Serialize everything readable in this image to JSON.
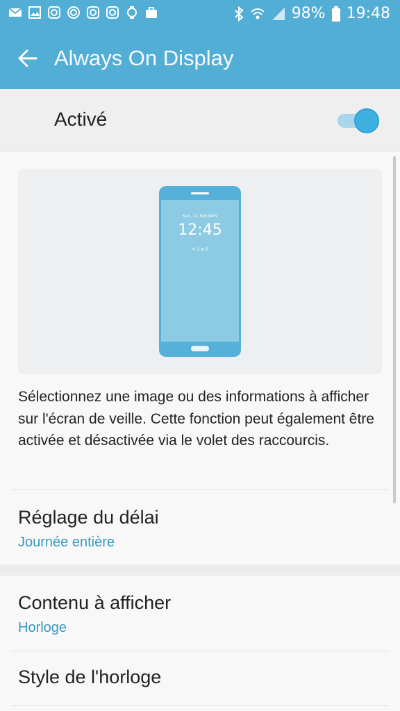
{
  "status_bar": {
    "left_icons": [
      "email-icon",
      "gallery-icon",
      "instagram-icon",
      "sync-icon",
      "instagram-icon",
      "instagram-icon",
      "watch-icon",
      "briefcase-icon"
    ],
    "battery_percent": "98%",
    "time": "19:48"
  },
  "app_bar": {
    "title": "Always On Display"
  },
  "master_switch": {
    "label": "Activé",
    "enabled": true,
    "accent_color": "#3db0e0"
  },
  "preview": {
    "date_text": "Sun, 21 Feb  84%",
    "clock_text": "12:45",
    "notif_text": "✈ 2    ✉ 6"
  },
  "description": "Sélectionnez une image ou des informations à afficher sur l'écran de veille. Cette fonction peut également être activée et désactivée via le volet des raccourcis.",
  "settings": [
    {
      "title": "Réglage du délai",
      "value": "Journée entière"
    },
    {
      "title": "Contenu à afficher",
      "value": "Horloge"
    },
    {
      "title": "Style de l'horloge"
    }
  ],
  "colors": {
    "header": "#53aed6",
    "link_value": "#3a98c0"
  }
}
